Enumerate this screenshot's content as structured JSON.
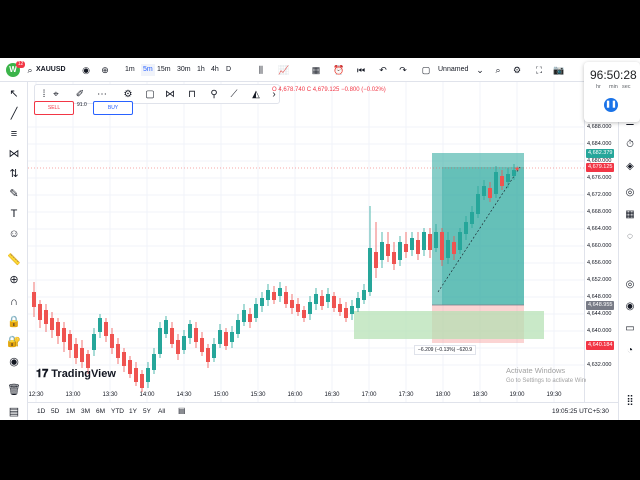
{
  "topbar": {
    "symbol": "XAUUSD",
    "badge": "12",
    "intervals": [
      "1m",
      "5m",
      "15m",
      "30m",
      "1h",
      "4h",
      "D"
    ],
    "active_interval": "5m",
    "layout_name": "Unnamed"
  },
  "ohlc": {
    "text": "4,678.740  C 4,679.125  −0.800 (−0.02%)"
  },
  "trade_widget": {
    "sell_price": "4,679.125",
    "sell_label": "SELL",
    "spread": "91.0",
    "buy_price": "4,679.125",
    "buy_label": "BUY"
  },
  "price_axis": {
    "ticks": [
      "4,688.000",
      "4,684.000",
      "4,680.000",
      "4,676.000",
      "4,672.000",
      "4,668.000",
      "4,664.000",
      "4,660.000",
      "4,656.000",
      "4,652.000",
      "4,648.000",
      "4,644.000",
      "4,640.000",
      "4,636.000",
      "4,632.000"
    ],
    "label_target": "4,682.379",
    "label_current": "4,679.125",
    "label_entry": "4,648.955",
    "label_stop": "4,640.184"
  },
  "time_axis": {
    "ticks": [
      "12:30",
      "13:00",
      "13:30",
      "14:00",
      "14:30",
      "15:00",
      "15:30",
      "16:00",
      "16:30",
      "17:00",
      "17:30",
      "18:00",
      "18:30",
      "19:00",
      "19:30"
    ]
  },
  "position_tool": {
    "label": "−6.209 (−0.13%)  −620.9"
  },
  "bottombar": {
    "ranges": [
      "1D",
      "5D",
      "1M",
      "3M",
      "6M",
      "YTD",
      "1Y",
      "5Y",
      "All"
    ],
    "clock": "19:05:25 UTC+5:30"
  },
  "logo": "TradingView",
  "timer": {
    "digits": "96:50:28",
    "units": [
      "hr",
      "min",
      "sec"
    ]
  },
  "watermark": {
    "line1": "Activate Windows",
    "line2": "Go to Settings to activate Windows."
  },
  "colors": {
    "up": "#26a69a",
    "down": "#ef5350",
    "accent": "#2962ff",
    "target_zone": "#26a69a",
    "stop_zone": "#ef5350",
    "profit_zone": "#b2dfb0"
  }
}
